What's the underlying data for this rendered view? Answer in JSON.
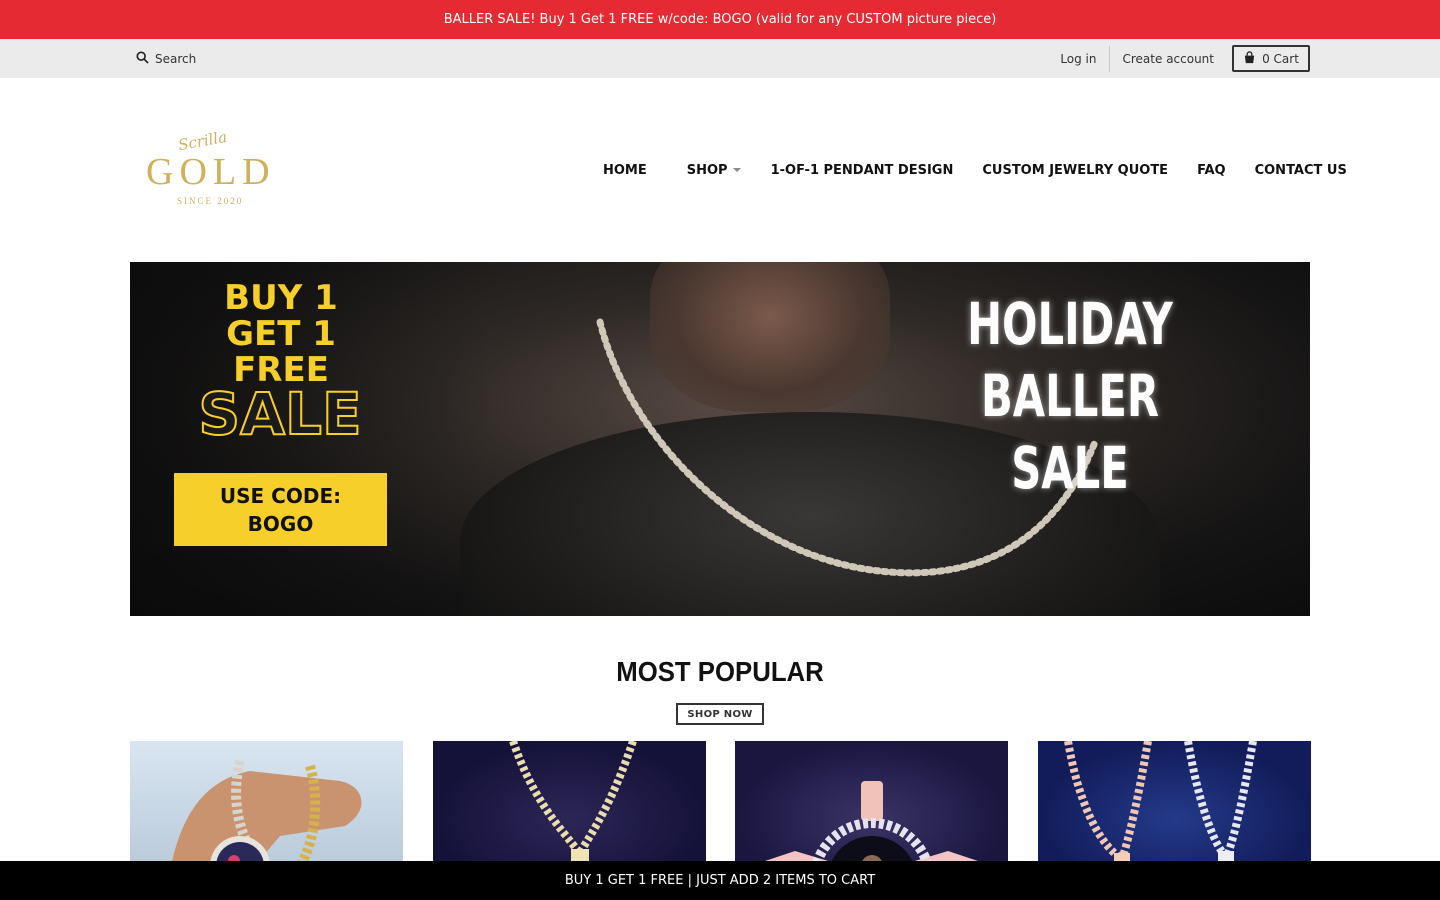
{
  "announcement": "BALLER SALE! Buy 1 Get 1 FREE w/code: BOGO (valid for any CUSTOM picture piece)",
  "utility": {
    "search_label": "Search",
    "login_label": "Log in",
    "create_account_label": "Create account",
    "cart_label": "0 Cart"
  },
  "logo": {
    "script": "Scrilla",
    "wordmark": "GOLD",
    "since": "SINCE 2020",
    "color": "#cfb15b"
  },
  "nav": {
    "home": "HOME",
    "shop": "SHOP",
    "pendant": "1-OF-1 PENDANT DESIGN",
    "quote": "CUSTOM JEWELRY QUOTE",
    "faq": "FAQ",
    "contact": "CONTACT US"
  },
  "hero": {
    "buy_line1": "BUY 1",
    "buy_line2": "GET 1 FREE",
    "sale": "SALE",
    "code_line1": "USE CODE:",
    "code_line2": "BOGO",
    "holiday_line1": "HOLIDAY BALLER",
    "holiday_line2": "SALE",
    "accent_color": "#f7cf2a"
  },
  "popular": {
    "title": "MOST POPULAR",
    "button": "SHOP NOW"
  },
  "bottom_bar": "BUY 1 GET 1 FREE | JUST ADD 2 ITEMS TO CART",
  "colors": {
    "announcement_bg": "#e52a33",
    "utility_bg": "#ebebeb",
    "bottom_bar_bg": "#000000"
  }
}
